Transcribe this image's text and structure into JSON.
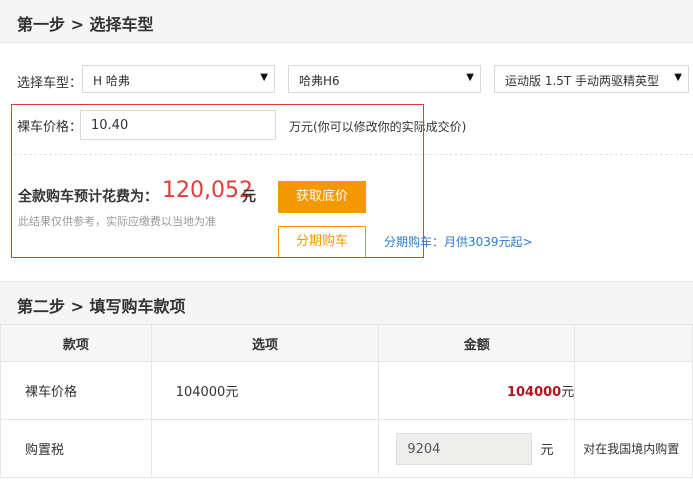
{
  "step1": {
    "title": "第一步 > 选择车型"
  },
  "select": {
    "label": "选择车型：",
    "brand": "H 哈弗",
    "series": "哈弗H6",
    "model": "运动版 1.5T 手动两驱精英型",
    "arrow": "▼"
  },
  "price": {
    "label": "裸车价格：",
    "value": "10.40",
    "unit_hint": "万元(你可以修改你的实际成交价)"
  },
  "total": {
    "label": "全款购车预计花费为：",
    "value": "120,052",
    "unit": "元",
    "note": "此结果仅供参考，实际应缴费以当地为准"
  },
  "buttons": {
    "get_price": "获取底价",
    "installment": "分期购车",
    "installment_link": "分期购车：月供3039元起>"
  },
  "step2": {
    "title": "第二步 > 填写购车款项"
  },
  "table": {
    "headers": [
      "款项",
      "选项",
      "金额",
      ""
    ],
    "rows": [
      {
        "item": "裸车价格",
        "option": "104000元",
        "amount": "104000",
        "amount_unit": "元",
        "note": ""
      },
      {
        "item": "购置税",
        "option": "",
        "amount": "9204",
        "amount_unit": "元",
        "note": "对在我国境内购置"
      }
    ]
  }
}
